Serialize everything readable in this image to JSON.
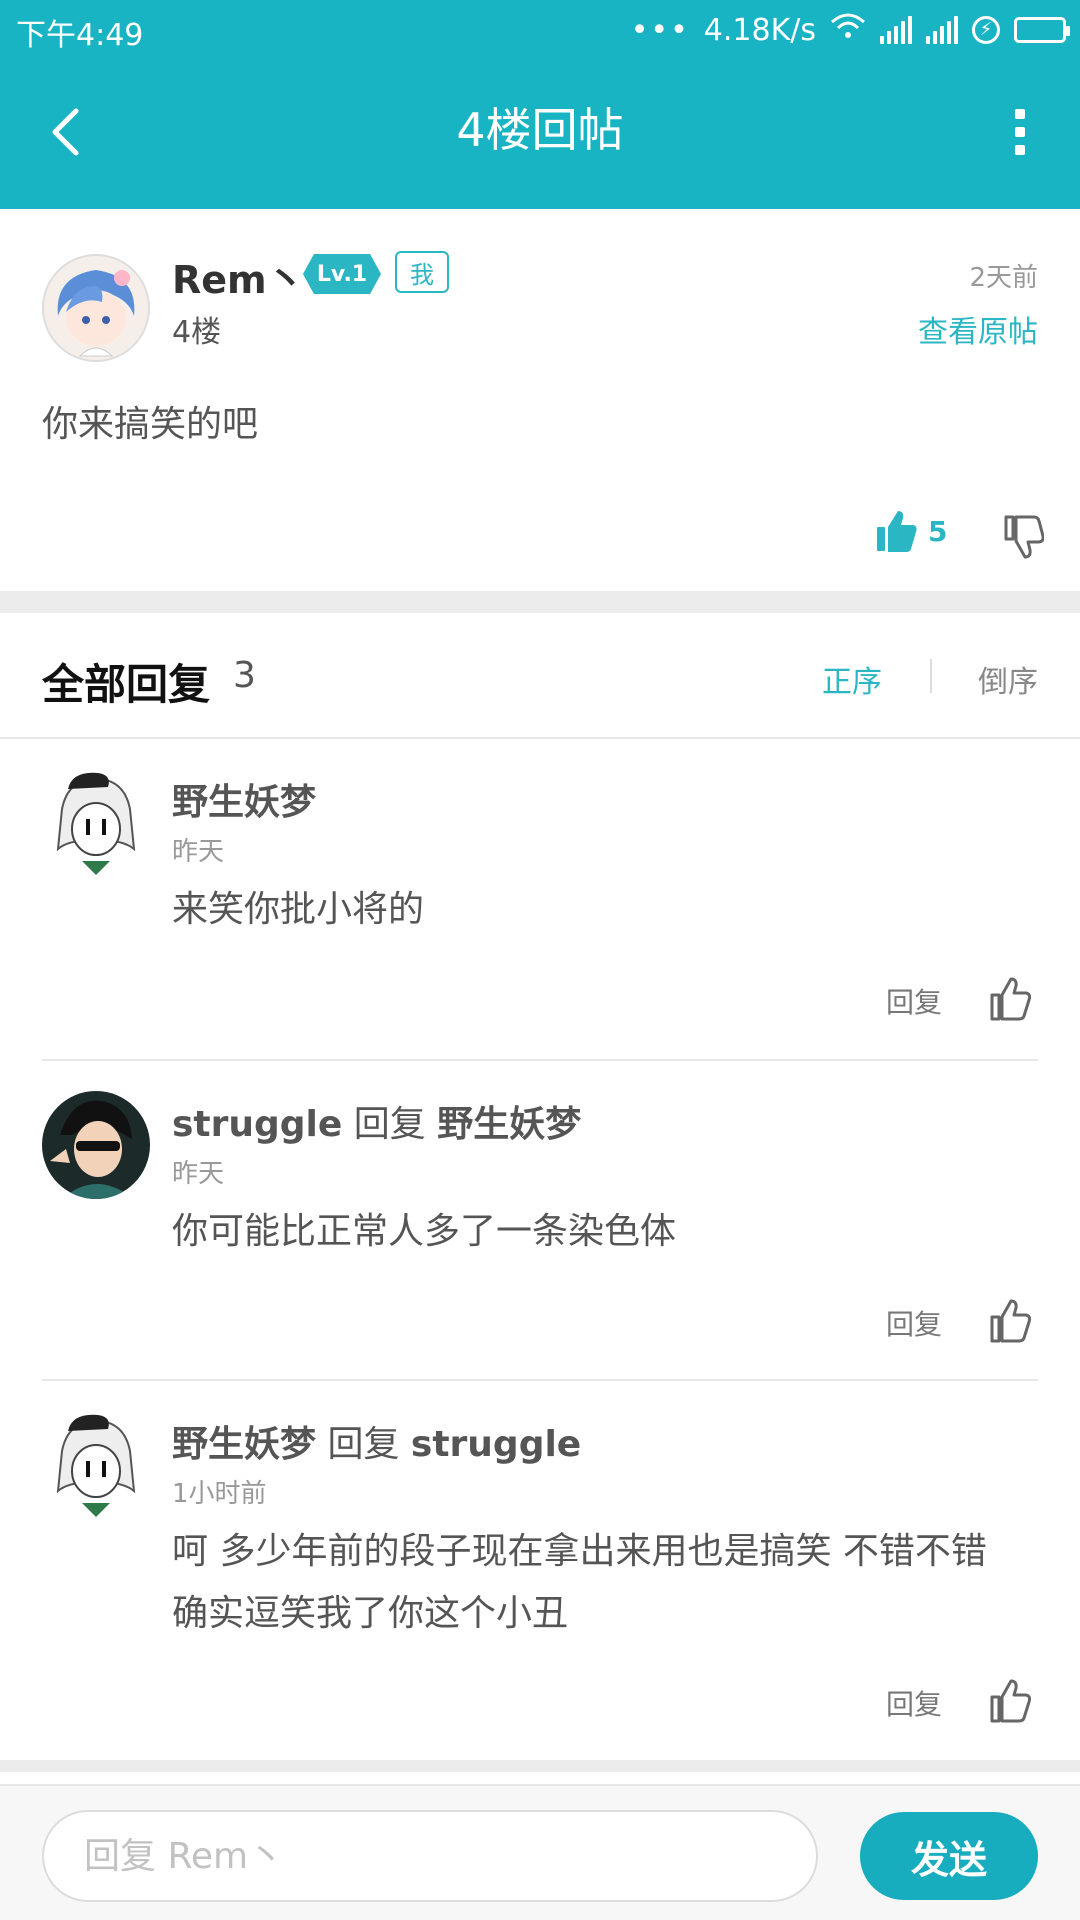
{
  "status_bar": {
    "time": "下午4:49",
    "dots": "•••",
    "speed": "4.18K/s"
  },
  "header": {
    "title": "4楼回帖"
  },
  "post": {
    "username": "Rem丶",
    "level": "Lv.1",
    "me_badge": "我",
    "floor": "4楼",
    "time": "2天前",
    "view_original": "查看原帖",
    "content": "你来搞笑的吧",
    "like_count": "5"
  },
  "replies_header": {
    "title": "全部回复",
    "count": "3",
    "sort_asc": "正序",
    "sort_desc": "倒序"
  },
  "replies": [
    {
      "author": "野生妖梦",
      "connector": "",
      "target": "",
      "time": "昨天",
      "text": "来笑你批小将的",
      "reply_label": "回复"
    },
    {
      "author": "struggle",
      "connector": " 回复 ",
      "target": "野生妖梦",
      "time": "昨天",
      "text": "你可能比正常人多了一条染色体",
      "reply_label": "回复"
    },
    {
      "author": "野生妖梦",
      "connector": " 回复 ",
      "target": "struggle",
      "time": "1小时前",
      "text": "呵 多少年前的段子现在拿出来用也是搞笑 不错不错确实逗笑我了你这个小丑",
      "reply_label": "回复"
    }
  ],
  "bottom_bar": {
    "placeholder": "回复 Rem丶",
    "send_label": "发送"
  },
  "colors": {
    "accent": "#18b4c4",
    "send": "#17adbe"
  }
}
